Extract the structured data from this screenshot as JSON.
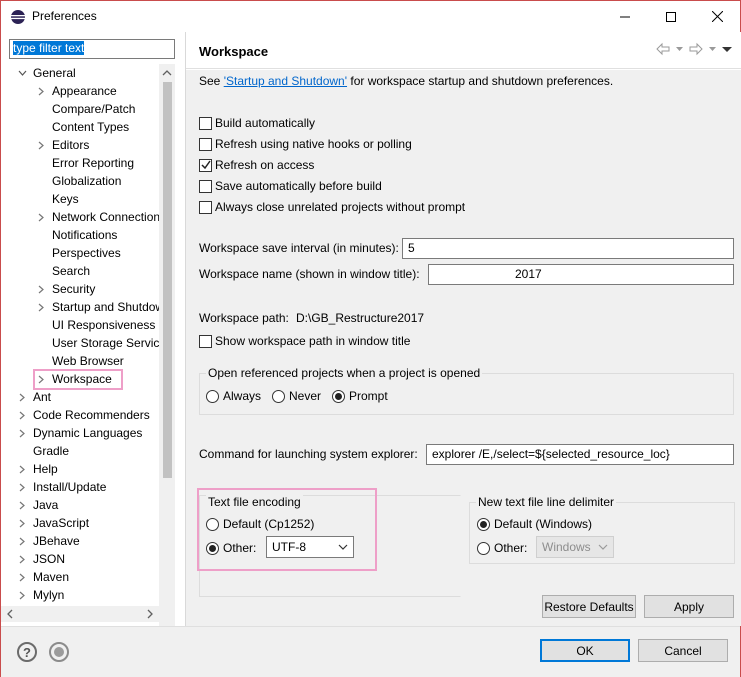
{
  "window": {
    "title": "Preferences"
  },
  "filter": {
    "value": "type filter text"
  },
  "tree": {
    "items": [
      {
        "label": "General",
        "expanded": true
      },
      {
        "label": "Appearance",
        "has_children": true
      },
      {
        "label": "Compare/Patch"
      },
      {
        "label": "Content Types"
      },
      {
        "label": "Editors",
        "has_children": true
      },
      {
        "label": "Error Reporting"
      },
      {
        "label": "Globalization"
      },
      {
        "label": "Keys"
      },
      {
        "label": "Network Connection",
        "has_children": true
      },
      {
        "label": "Notifications"
      },
      {
        "label": "Perspectives"
      },
      {
        "label": "Search"
      },
      {
        "label": "Security",
        "has_children": true
      },
      {
        "label": "Startup and Shutdow",
        "has_children": true
      },
      {
        "label": "UI Responsiveness M"
      },
      {
        "label": "User Storage Service"
      },
      {
        "label": "Web Browser"
      },
      {
        "label": "Workspace",
        "has_children": true,
        "selected": true
      },
      {
        "label": "Ant",
        "has_children": true
      },
      {
        "label": "Code Recommenders",
        "has_children": true
      },
      {
        "label": "Dynamic Languages",
        "has_children": true
      },
      {
        "label": "Gradle"
      },
      {
        "label": "Help",
        "has_children": true
      },
      {
        "label": "Install/Update",
        "has_children": true
      },
      {
        "label": "Java",
        "has_children": true
      },
      {
        "label": "JavaScript",
        "has_children": true
      },
      {
        "label": "JBehave",
        "has_children": true
      },
      {
        "label": "JSON",
        "has_children": true
      },
      {
        "label": "Maven",
        "has_children": true
      },
      {
        "label": "Mylyn",
        "has_children": true
      }
    ]
  },
  "page": {
    "title": "Workspace",
    "see_prefix": "See ",
    "see_link": "'Startup and Shutdown'",
    "see_suffix": " for workspace startup and shutdown preferences.",
    "checkboxes": [
      {
        "label": "Build automatically",
        "checked": false
      },
      {
        "label": "Refresh using native hooks or polling",
        "checked": false
      },
      {
        "label": "Refresh on access",
        "checked": true
      },
      {
        "label": "Save automatically before build",
        "checked": false
      },
      {
        "label": "Always close unrelated projects without prompt",
        "checked": false
      }
    ],
    "save_interval_label": "Workspace save interval (in minutes):",
    "save_interval_value": "5",
    "ws_name_label": "Workspace name (shown in window title):",
    "ws_name_value": "2017",
    "ws_path_label": "Workspace path:",
    "ws_path_value": "D:\\GB_Restructure2017",
    "show_path_label": "Show workspace path in window title",
    "open_ref_title": "Open referenced projects when a project is opened",
    "open_ref_options": [
      {
        "label": "Always",
        "selected": false
      },
      {
        "label": "Never",
        "selected": false
      },
      {
        "label": "Prompt",
        "selected": true
      }
    ],
    "cmd_label": "Command for launching system explorer:",
    "cmd_value": "explorer /E,/select=${selected_resource_loc}",
    "encoding_title": "Text file encoding",
    "encoding_default": "Default (Cp1252)",
    "encoding_other": "Other:",
    "encoding_value": "UTF-8",
    "delim_title": "New text file line delimiter",
    "delim_default": "Default (Windows)",
    "delim_other": "Other:",
    "delim_value": "Windows",
    "restore_defaults": "Restore Defaults",
    "apply": "Apply"
  },
  "footer": {
    "ok": "OK",
    "cancel": "Cancel"
  },
  "colors": {
    "highlight": "#ee9fc8",
    "link": "#0066cc",
    "window_border": "#c94c4c"
  }
}
